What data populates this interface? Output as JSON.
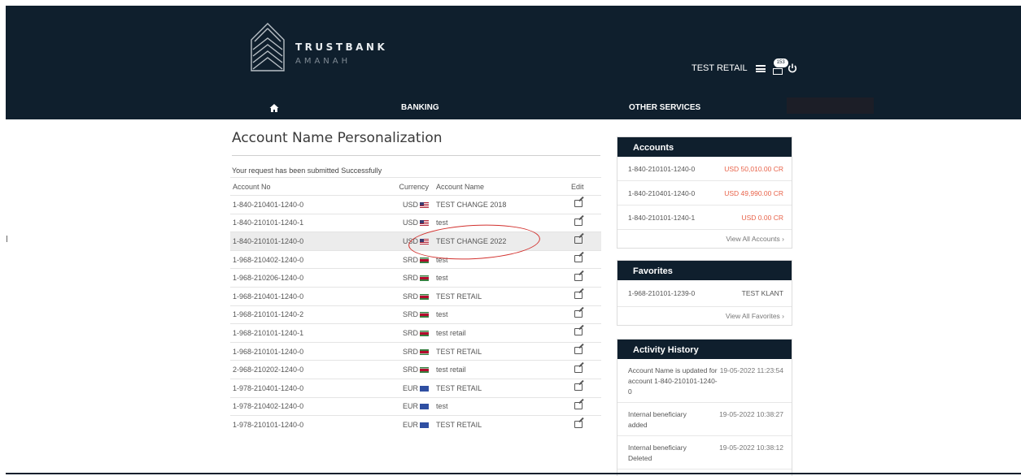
{
  "header": {
    "brand_line1": "TRUSTBANK",
    "brand_line2": "AMANAH",
    "user_name": "TEST RETAIL",
    "mail_badge": "153"
  },
  "nav": {
    "banking": "BANKING",
    "other_services": "OTHER SERVICES"
  },
  "main": {
    "title": "Account Name Personalization",
    "success_message": "Your request has been submitted Successfully",
    "columns": [
      "Account No",
      "Currency",
      "Account Name",
      "Edit"
    ],
    "rows": [
      {
        "account": "1-840-210401-1240-0",
        "currency": "USD",
        "flag": "usd",
        "name": "TEST CHANGE 2018"
      },
      {
        "account": "1-840-210101-1240-1",
        "currency": "USD",
        "flag": "usd",
        "name": "test"
      },
      {
        "account": "1-840-210101-1240-0",
        "currency": "USD",
        "flag": "usd",
        "name": "TEST CHANGE 2022",
        "highlight": true
      },
      {
        "account": "1-968-210402-1240-0",
        "currency": "SRD",
        "flag": "srd",
        "name": "test"
      },
      {
        "account": "1-968-210206-1240-0",
        "currency": "SRD",
        "flag": "srd",
        "name": "test"
      },
      {
        "account": "1-968-210401-1240-0",
        "currency": "SRD",
        "flag": "srd",
        "name": "TEST RETAIL"
      },
      {
        "account": "1-968-210101-1240-2",
        "currency": "SRD",
        "flag": "srd",
        "name": "test"
      },
      {
        "account": "1-968-210101-1240-1",
        "currency": "SRD",
        "flag": "srd",
        "name": "test retail"
      },
      {
        "account": "1-968-210101-1240-0",
        "currency": "SRD",
        "flag": "srd",
        "name": "TEST RETAIL"
      },
      {
        "account": "2-968-210202-1240-0",
        "currency": "SRD",
        "flag": "srd",
        "name": "test retail"
      },
      {
        "account": "1-978-210401-1240-0",
        "currency": "EUR",
        "flag": "eur",
        "name": "TEST RETAIL"
      },
      {
        "account": "1-978-210402-1240-0",
        "currency": "EUR",
        "flag": "eur",
        "name": "test"
      },
      {
        "account": "1-978-210101-1240-0",
        "currency": "EUR",
        "flag": "eur",
        "name": "TEST RETAIL"
      }
    ]
  },
  "sidebar": {
    "accounts": {
      "title": "Accounts",
      "items": [
        {
          "account": "1-840-210101-1240-0",
          "amount": "USD 50,010.00 CR"
        },
        {
          "account": "1-840-210401-1240-0",
          "amount": "USD 49,990.00 CR"
        },
        {
          "account": "1-840-210101-1240-1",
          "amount": "USD 0.00 CR"
        }
      ],
      "link": "View All Accounts ›"
    },
    "favorites": {
      "title": "Favorites",
      "items": [
        {
          "account": "1-968-210101-1239-0",
          "name": "TEST KLANT"
        }
      ],
      "link": "View All Favorites ›"
    },
    "activity": {
      "title": "Activity History",
      "items": [
        {
          "text": "Account Name is updated for account 1-840-210101-1240-0",
          "time": "19-05-2022 11:23:54"
        },
        {
          "text": "Internal beneficiary added",
          "time": "19-05-2022 10:38:27"
        },
        {
          "text": "Internal beneficiary Deleted",
          "time": "19-05-2022 10:38:12"
        }
      ]
    }
  },
  "colors": {
    "header_bg": "#0f1f2d",
    "amount_text": "#e8634a",
    "annotation": "#d2312e",
    "highlight_row": "#ececec"
  }
}
